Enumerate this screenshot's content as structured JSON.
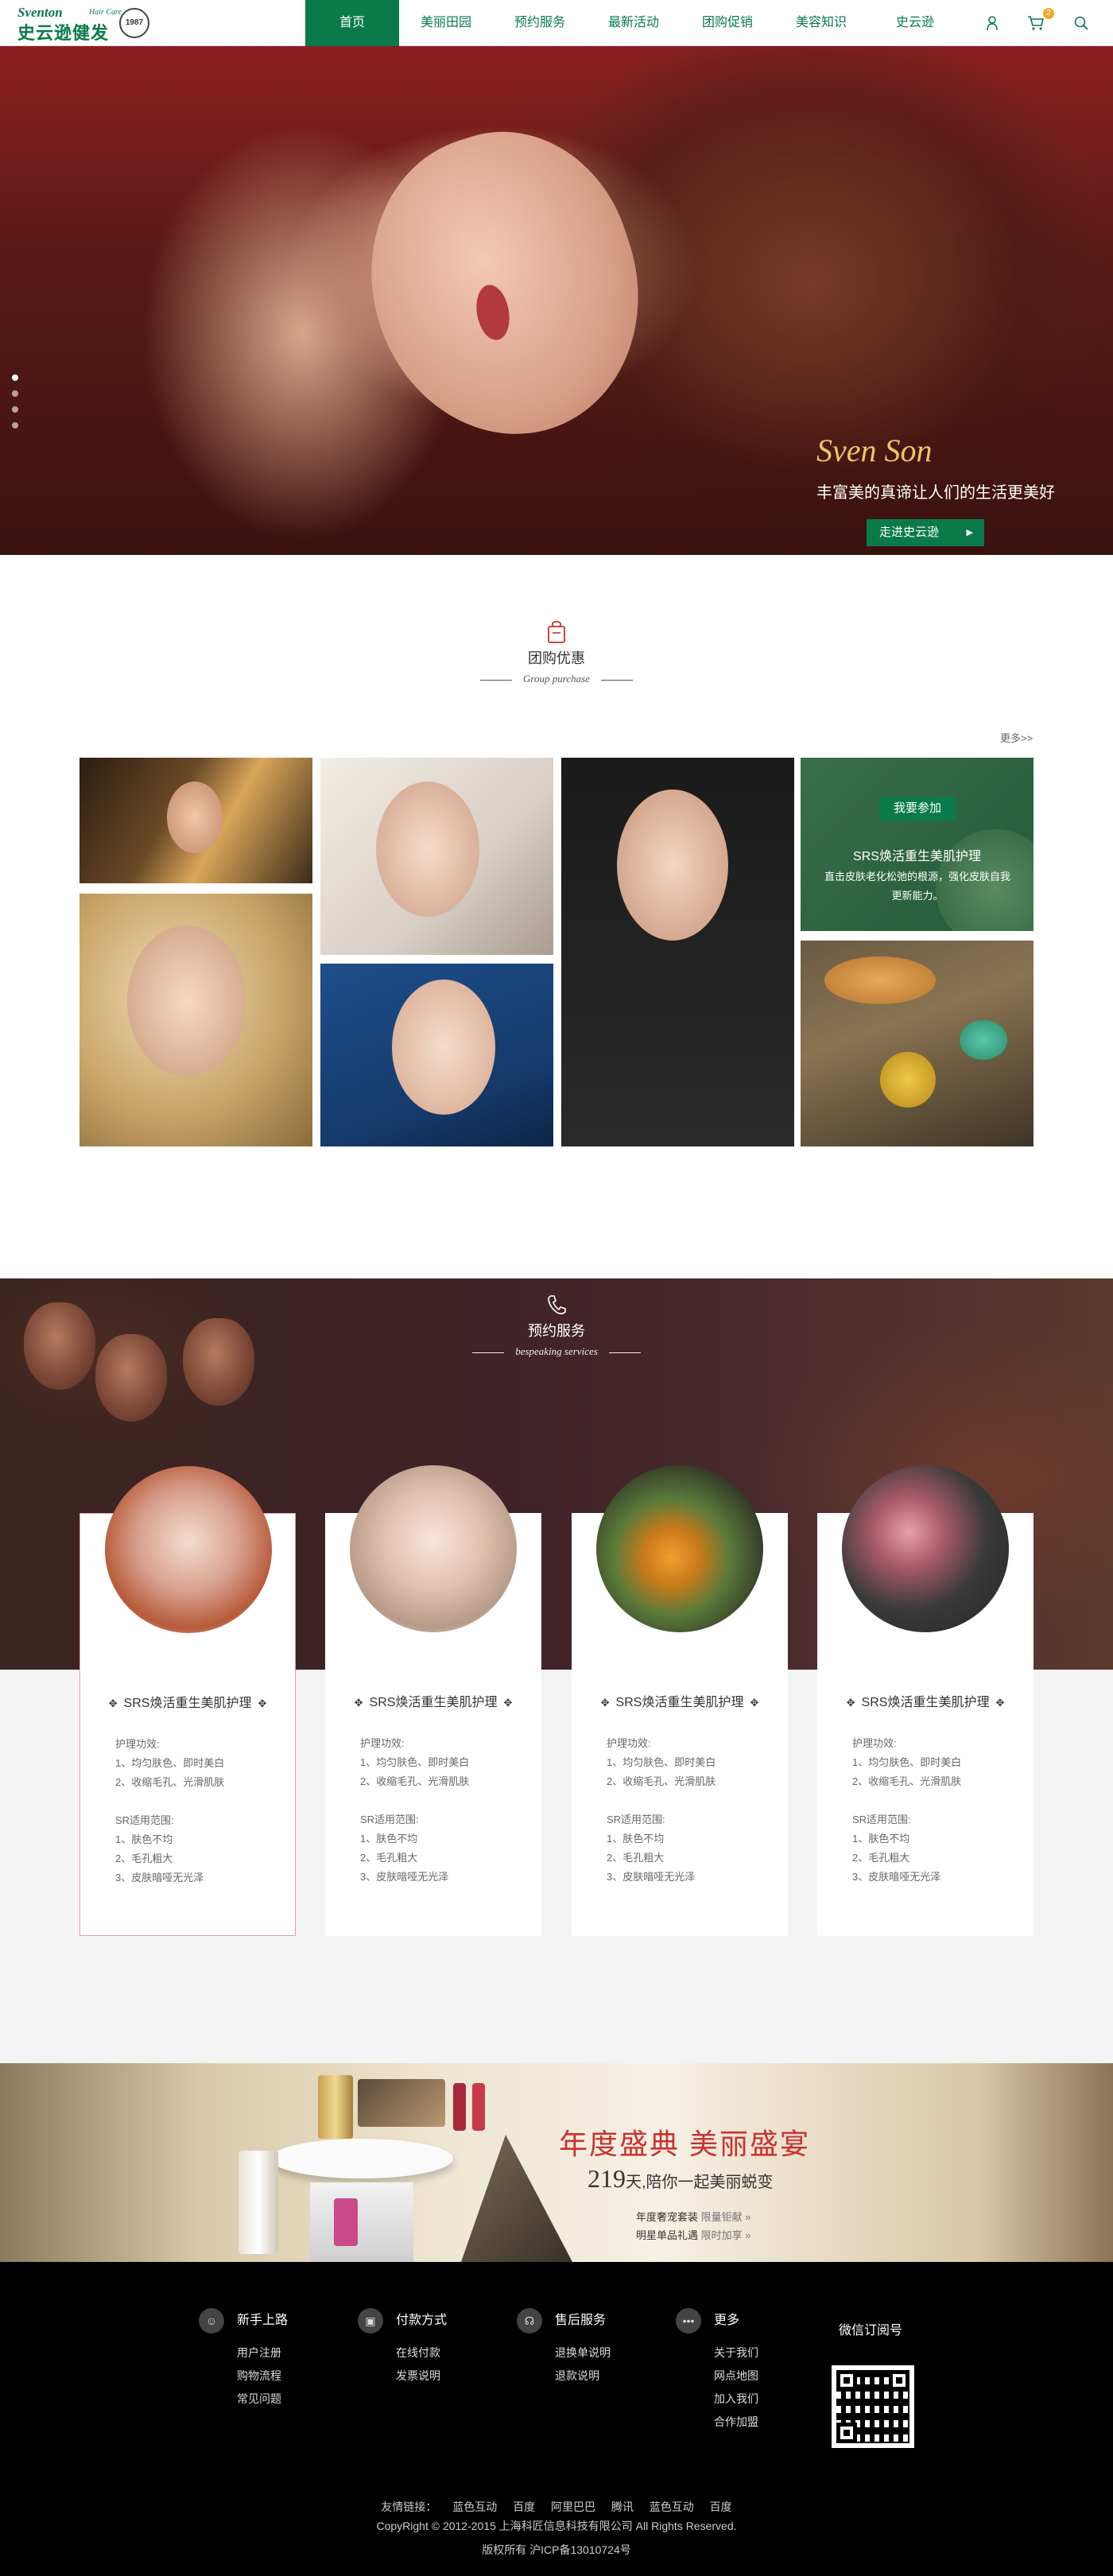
{
  "brand": {
    "name_en": "Sventon",
    "tagline_en": "Hair Care",
    "name_cn": "史云逊健发",
    "seal_text": "1987"
  },
  "nav": {
    "items": [
      {
        "label": "首页",
        "active": true
      },
      {
        "label": "美丽田园",
        "active": false
      },
      {
        "label": "预约服务",
        "active": false
      },
      {
        "label": "最新活动",
        "active": false
      },
      {
        "label": "团购促销",
        "active": false
      },
      {
        "label": "美容知识",
        "active": false
      },
      {
        "label": "史云逊",
        "active": false
      }
    ],
    "cart_count": "2",
    "icons": [
      "user-icon",
      "cart-icon",
      "search-icon"
    ]
  },
  "hero": {
    "script_title": "Sven Son",
    "slogan": "丰富美的真谛让人们的生活更美好",
    "button_label": "走进史云逊",
    "slides": 4,
    "active_slide": 0
  },
  "group": {
    "title_cn": "团购优惠",
    "title_en": "Group purchase",
    "more_label": "更多>>",
    "promo": {
      "button_label": "我要参加",
      "title": "SRS焕活重生美肌护理",
      "desc": "直击皮肤老化松弛的根源，强化皮肤自我更新能力。"
    }
  },
  "booking": {
    "title_cn": "预约服务",
    "title_en": "bespeaking services",
    "cards": [
      {
        "title": "SRS焕活重生美肌护理",
        "effect_head": "护理功效:",
        "effects": [
          "1、均匀肤色、即时美白",
          "2、收缩毛孔、光滑肌肤"
        ],
        "scope_head": "SR适用范围:",
        "scopes": [
          "1、肤色不均",
          "2、毛孔粗大",
          "3、皮肤暗哑无光泽"
        ]
      },
      {
        "title": "SRS焕活重生美肌护理",
        "effect_head": "护理功效:",
        "effects": [
          "1、均匀肤色、即时美白",
          "2、收缩毛孔、光滑肌肤"
        ],
        "scope_head": "SR适用范围:",
        "scopes": [
          "1、肤色不均",
          "2、毛孔粗大",
          "3、皮肤暗哑无光泽"
        ]
      },
      {
        "title": "SRS焕活重生美肌护理",
        "effect_head": "护理功效:",
        "effects": [
          "1、均匀肤色、即时美白",
          "2、收缩毛孔、光滑肌肤"
        ],
        "scope_head": "SR适用范围:",
        "scopes": [
          "1、肤色不均",
          "2、毛孔粗大",
          "3、皮肤暗哑无光泽"
        ]
      },
      {
        "title": "SRS焕活重生美肌护理",
        "effect_head": "护理功效:",
        "effects": [
          "1、均匀肤色、即时美白",
          "2、收缩毛孔、光滑肌肤"
        ],
        "scope_head": "SR适用范围:",
        "scopes": [
          "1、肤色不均",
          "2、毛孔粗大",
          "3、皮肤暗哑无光泽"
        ]
      }
    ]
  },
  "banner": {
    "title": "年度盛典 美丽盛宴",
    "days_num": "219",
    "days_text": "天,陪你一起美丽蜕变",
    "line1_main": "年度奢宠套装",
    "line1_hl": "限量钜献 »",
    "line2_main": "明星单品礼遇",
    "line2_hl": "限时加享 »"
  },
  "footer": {
    "columns": [
      {
        "head": "新手上路",
        "icon": "user-guide-icon",
        "links": [
          "用户注册",
          "购物流程",
          "常见问题"
        ]
      },
      {
        "head": "付款方式",
        "icon": "wallet-icon",
        "links": [
          "在线付款",
          "发票说明"
        ]
      },
      {
        "head": "售后服务",
        "icon": "headset-icon",
        "links": [
          "退换单说明",
          "退款说明"
        ]
      },
      {
        "head": "更多",
        "icon": "more-icon",
        "links": [
          "关于我们",
          "网点地图",
          "加入我们",
          "合作加盟"
        ]
      }
    ],
    "qr_title": "微信订阅号",
    "friend_label": "友情链接：",
    "friend_links": [
      "蓝色互动",
      "百度",
      "阿里巴巴",
      "腾讯",
      "蓝色互动",
      "百度"
    ],
    "copyright": "CopyRight © 2012-2015 上海科匠信息科技有限公司 All Rights Reserved.",
    "icp": "版权所有 沪ICP备13010724号"
  },
  "colors": {
    "brand_green": "#0a7a4b",
    "accent_red": "#c8322f",
    "badge_orange": "#f5a623"
  }
}
